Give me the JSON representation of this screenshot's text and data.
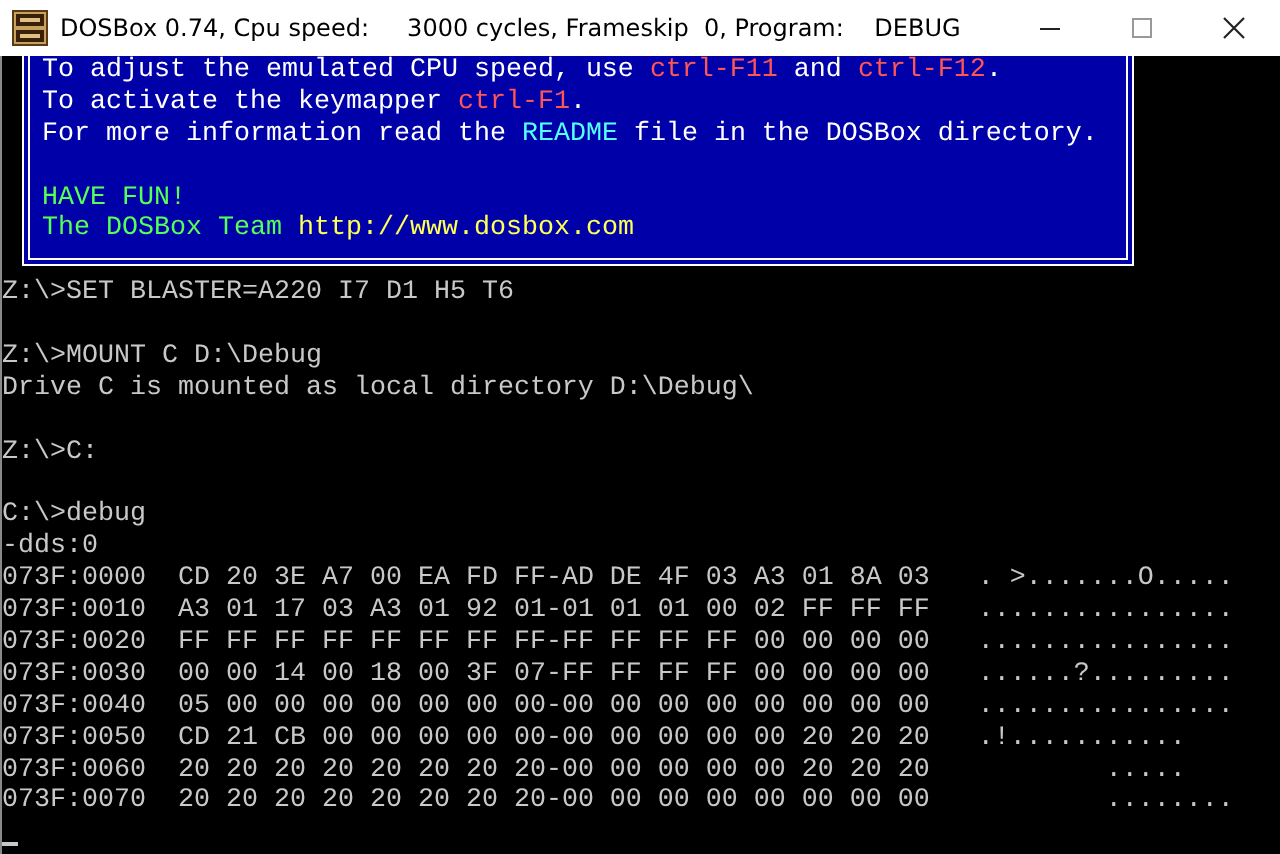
{
  "window": {
    "title": "DOSBox 0.74, Cpu speed:     3000 cycles, Frameskip  0, Program:    DEBUG"
  },
  "welcome_box": {
    "lines": [
      {
        "kind": "text",
        "segments": [
          {
            "kind": "plain",
            "text": "To adjust the emulated CPU speed, use "
          },
          {
            "kind": "key",
            "text": "ctrl-F11"
          },
          {
            "kind": "plain",
            "text": " and "
          },
          {
            "kind": "key",
            "text": "ctrl-F12"
          },
          {
            "kind": "plain",
            "text": "."
          }
        ]
      },
      {
        "kind": "text",
        "segments": [
          {
            "kind": "plain",
            "text": "To activate the keymapper "
          },
          {
            "kind": "key",
            "text": "ctrl-F1"
          },
          {
            "kind": "plain",
            "text": "."
          }
        ]
      },
      {
        "kind": "text",
        "segments": [
          {
            "kind": "plain",
            "text": "For more information read the "
          },
          {
            "kind": "link",
            "text": "README"
          },
          {
            "kind": "plain",
            "text": " file in the DOSBox directory."
          }
        ]
      },
      {
        "kind": "blank"
      },
      {
        "kind": "text",
        "segments": [
          {
            "kind": "greeting",
            "text": "HAVE FUN!"
          }
        ]
      },
      {
        "kind": "text",
        "segments": [
          {
            "kind": "greeting",
            "text": "The DOSBox Team "
          },
          {
            "kind": "url",
            "text": "http://www.dosbox.com"
          }
        ]
      }
    ]
  },
  "console": {
    "lines": [
      {
        "kind": "text",
        "text": "Z:\\>SET BLASTER=A220 I7 D1 H5 T6"
      },
      {
        "kind": "blank"
      },
      {
        "kind": "text",
        "text": "Z:\\>MOUNT C D:\\Debug"
      },
      {
        "kind": "text",
        "text": "Drive C is mounted as local directory D:\\Debug\\"
      },
      {
        "kind": "blank"
      },
      {
        "kind": "text",
        "text": "Z:\\>C:"
      },
      {
        "kind": "blank"
      },
      {
        "kind": "text",
        "text": "C:\\>debug"
      },
      {
        "kind": "text",
        "text": "-dds:0"
      },
      {
        "kind": "dump",
        "address": "073F:0000",
        "bytes": "CD 20 3E A7 00 EA FD FF-AD DE 4F 03 A3 01 8A 03",
        "ascii": ". >.......O....."
      },
      {
        "kind": "dump",
        "address": "073F:0010",
        "bytes": "A3 01 17 03 A3 01 92 01-01 01 01 00 02 FF FF FF",
        "ascii": "................"
      },
      {
        "kind": "dump",
        "address": "073F:0020",
        "bytes": "FF FF FF FF FF FF FF FF-FF FF FF FF 00 00 00 00",
        "ascii": "................"
      },
      {
        "kind": "dump",
        "address": "073F:0030",
        "bytes": "00 00 14 00 18 00 3F 07-FF FF FF FF 00 00 00 00",
        "ascii": "......?........."
      },
      {
        "kind": "dump",
        "address": "073F:0040",
        "bytes": "05 00 00 00 00 00 00 00-00 00 00 00 00 00 00 00",
        "ascii": "................"
      },
      {
        "kind": "dump",
        "address": "073F:0050",
        "bytes": "CD 21 CB 00 00 00 00 00-00 00 00 00 00 20 20 20",
        "ascii": ".!..........."
      },
      {
        "kind": "dump",
        "address": "073F:0060",
        "bytes": "20 20 20 20 20 20 20 20-00 00 00 00 00 20 20 20",
        "ascii": "        ....."
      },
      {
        "kind": "dump",
        "address": "073F:0070",
        "bytes": "20 20 20 20 20 20 20 20-00 00 00 00 00 00 00 00",
        "ascii": "        ........"
      },
      {
        "kind": "cursor"
      }
    ]
  }
}
